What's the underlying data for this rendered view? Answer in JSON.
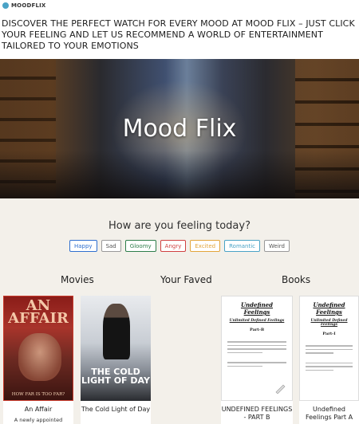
{
  "app": {
    "brand": "MOODFLIX"
  },
  "headline": "DISCOVER THE PERFECT WATCH FOR EVERY MOOD AT MOOD FLIX – JUST CLICK YOUR FEELING AND LET US RECOMMEND A WORLD OF ENTERTAINMENT TAILORED TO YOUR EMOTIONS",
  "hero": {
    "title": "Mood Flix"
  },
  "mood": {
    "question": "How are you feeling today?",
    "options": [
      {
        "label": "Happy",
        "color": "#2f6fcf"
      },
      {
        "label": "Sad",
        "color": "#555555"
      },
      {
        "label": "Gloomy",
        "color": "#2e7d4a"
      },
      {
        "label": "Angry",
        "color": "#d04040"
      },
      {
        "label": "Excited",
        "color": "#e3a53a"
      },
      {
        "label": "Romantic",
        "color": "#4aa3c6"
      },
      {
        "label": "Weird",
        "color": "#555555"
      }
    ]
  },
  "sections": {
    "movies": "Movies",
    "faved": "Your Faved",
    "books": "Books"
  },
  "movies": [
    {
      "title": "An Affair",
      "poster_title": "AN AFFAIR",
      "poster_tagline": "HOW FAR IS TOO FAR?",
      "subtitle": "A newly appointed"
    },
    {
      "title": "The Cold Light of Day",
      "poster_title": "THE COLD LIGHT OF DAY"
    }
  ],
  "books": [
    {
      "title": "UNDEFINED FEELINGS - PART B",
      "doc_title": "Undefined Feelings",
      "doc_subtitle": "Unlimited Defined Feelings",
      "doc_part": "Part-B"
    },
    {
      "title": "Undefined Feelings Part A",
      "doc_title": "Undefined Feelings",
      "doc_subtitle": "Unlimited Defined Feelings",
      "doc_part": "Part-I"
    }
  ]
}
